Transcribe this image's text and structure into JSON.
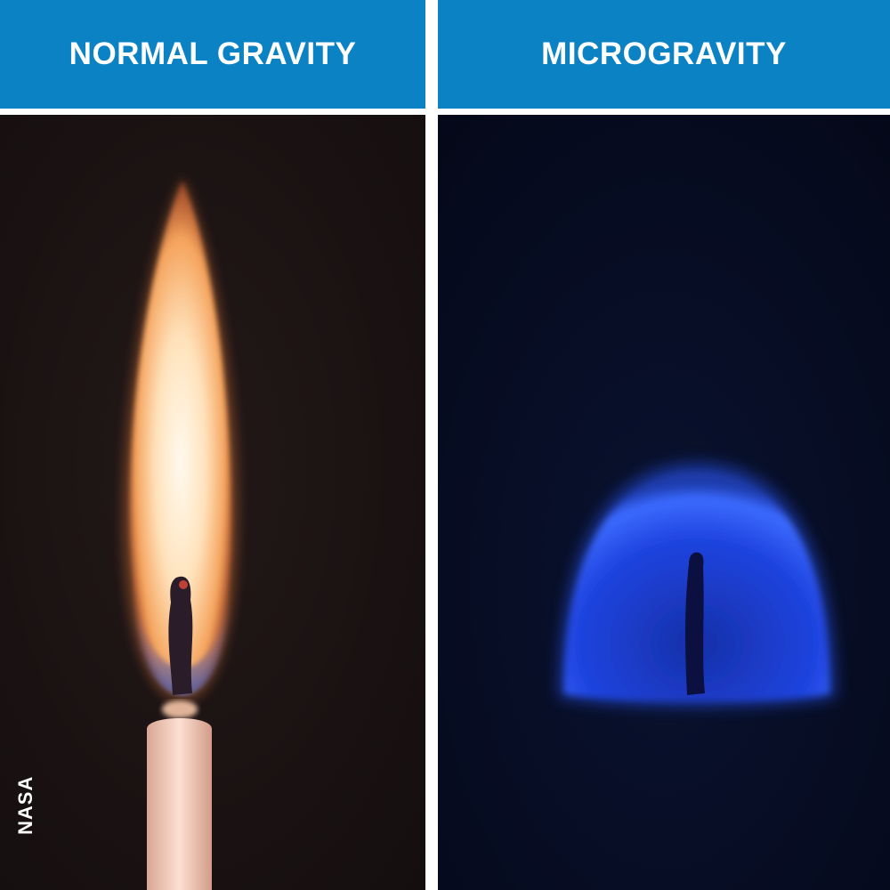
{
  "colors": {
    "header_background": "#0a82c4",
    "header_text": "#ffffff",
    "divider": "#ffffff",
    "left_background": "#1c1414",
    "right_background": "#050a1c",
    "normal_flame_core": "#fff3dc",
    "normal_flame_outer": "#f28a3c",
    "micro_flame": "#2456ff"
  },
  "panels": {
    "left": {
      "title": "NORMAL GRAVITY"
    },
    "right": {
      "title": "MICROGRAVITY"
    }
  },
  "credit": "NASA"
}
